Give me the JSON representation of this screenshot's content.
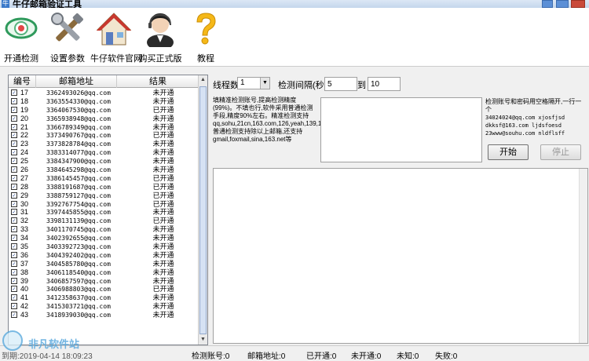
{
  "window": {
    "title": "牛仔邮箱验证工具",
    "app_icon": "牛"
  },
  "toolbar": {
    "items": [
      {
        "label": "开通检测",
        "icon": "eye-icon"
      },
      {
        "label": "设置参数",
        "icon": "tools-icon"
      },
      {
        "label": "牛仔软件官网",
        "icon": "home-icon"
      },
      {
        "label": "购买正式版",
        "icon": "support-person-icon"
      },
      {
        "label": "教程",
        "icon": "question-icon"
      }
    ]
  },
  "table": {
    "columns": [
      "编号",
      "邮箱地址",
      "结果"
    ],
    "rows": [
      {
        "num": "17",
        "email": "3362493026@qq.com",
        "result": "未开通"
      },
      {
        "num": "18",
        "email": "3363554330@qq.com",
        "result": "未开通"
      },
      {
        "num": "19",
        "email": "3364067530@qq.com",
        "result": "已开通"
      },
      {
        "num": "20",
        "email": "3365938948@qq.com",
        "result": "未开通"
      },
      {
        "num": "21",
        "email": "3366789349@qq.com",
        "result": "未开通"
      },
      {
        "num": "22",
        "email": "3373490767@qq.com",
        "result": "已开通"
      },
      {
        "num": "23",
        "email": "3373828784@qq.com",
        "result": "未开通"
      },
      {
        "num": "24",
        "email": "3383314077@qq.com",
        "result": "未开通"
      },
      {
        "num": "25",
        "email": "3384347900@qq.com",
        "result": "未开通"
      },
      {
        "num": "26",
        "email": "3384645298@qq.com",
        "result": "未开通"
      },
      {
        "num": "27",
        "email": "3386145457@qq.com",
        "result": "已开通"
      },
      {
        "num": "28",
        "email": "3388191687@qq.com",
        "result": "已开通"
      },
      {
        "num": "29",
        "email": "3388759127@qq.com",
        "result": "已开通"
      },
      {
        "num": "30",
        "email": "3392767754@qq.com",
        "result": "已开通"
      },
      {
        "num": "31",
        "email": "3397445855@qq.com",
        "result": "未开通"
      },
      {
        "num": "32",
        "email": "3398131139@qq.com",
        "result": "已开通"
      },
      {
        "num": "33",
        "email": "3401170745@qq.com",
        "result": "未开通"
      },
      {
        "num": "34",
        "email": "3402392655@qq.com",
        "result": "未开通"
      },
      {
        "num": "35",
        "email": "3403392723@qq.com",
        "result": "未开通"
      },
      {
        "num": "36",
        "email": "3404392402@qq.com",
        "result": "未开通"
      },
      {
        "num": "37",
        "email": "3404585780@qq.com",
        "result": "未开通"
      },
      {
        "num": "38",
        "email": "3406118540@qq.com",
        "result": "未开通"
      },
      {
        "num": "39",
        "email": "3406857597@qq.com",
        "result": "未开通"
      },
      {
        "num": "40",
        "email": "3406988803@qq.com",
        "result": "已开通"
      },
      {
        "num": "41",
        "email": "3412358637@qq.com",
        "result": "未开通"
      },
      {
        "num": "42",
        "email": "3415303721@qq.com",
        "result": "未开通"
      },
      {
        "num": "43",
        "email": "3418939030@qq.com",
        "result": "未开通"
      }
    ]
  },
  "settings": {
    "threads_label": "线程数",
    "threads_value": "1",
    "interval_label": "检测间隔(秒)",
    "interval_from": "5",
    "interval_to_label": "到",
    "interval_to": "10"
  },
  "hint": {
    "left": "填精准检测账号,提高检测精度(99%)。不填也行,软件采用普通检测手段,精度90%左右。精准检测支持qq,sohu,21cn,163.com,126,yeah,139,189,aliyun。普通检测支持除以上邮箱,还支持gmail,foxmail,sina,163.net等",
    "right_title": "检测账号和密码用空格隔开,一行一个",
    "right_example_lines": [
      "34024024@qq.com   xjosfjsd",
      "dkksf@163.com     ljdsfoesd",
      "23www@souhu.com   nldflsff"
    ]
  },
  "buttons": {
    "start": "开始",
    "stop": "停止"
  },
  "status": {
    "expiry": "到期:2019-04-14 18:09:23",
    "checked": "检测账号:0",
    "emails": "邮箱地址:0",
    "opened": "已开通:0",
    "not_opened": "未开通:0",
    "unknown": "未知:0",
    "failed": "失败:0"
  },
  "watermark": "非凡软件站"
}
